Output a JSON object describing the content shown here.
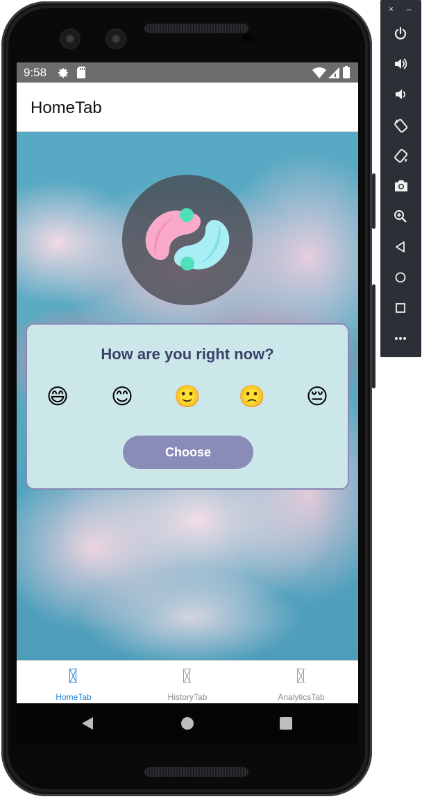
{
  "status_bar": {
    "time": "9:58",
    "icons": [
      "gear-icon",
      "sd-card-icon",
      "wifi-icon",
      "signal-icon",
      "battery-icon"
    ]
  },
  "app_bar": {
    "title": "HomeTab"
  },
  "mood_card": {
    "question": "How are you right now?",
    "moods": [
      {
        "name": "grinning-face",
        "glyph": "😄"
      },
      {
        "name": "smiling-face",
        "glyph": "😊"
      },
      {
        "name": "slightly-smiling-face",
        "glyph": "🙂"
      },
      {
        "name": "slightly-frowning-face",
        "glyph": "🙁"
      },
      {
        "name": "pensive-face",
        "glyph": "😔"
      }
    ],
    "button_label": "Choose"
  },
  "tabs": [
    {
      "label": "HomeTab",
      "active": true
    },
    {
      "label": "HistoryTab",
      "active": false
    },
    {
      "label": "AnalyticsTab",
      "active": false
    }
  ],
  "nav_buttons": [
    "back-icon",
    "home-icon",
    "recents-icon"
  ],
  "emulator_panel": {
    "window_controls": [
      "×",
      "–"
    ],
    "buttons": [
      "power-icon",
      "volume-up-icon",
      "volume-down-icon",
      "rotate-left-icon",
      "rotate-right-icon",
      "camera-icon",
      "zoom-icon",
      "back-icon",
      "home-icon",
      "overview-icon",
      "more-icon"
    ]
  },
  "colors": {
    "accent": "#1a7fd4",
    "card_background": "#cce7ea",
    "card_border": "#8789b4",
    "button": "#8a8cb8",
    "question_text": "#3a416a"
  }
}
